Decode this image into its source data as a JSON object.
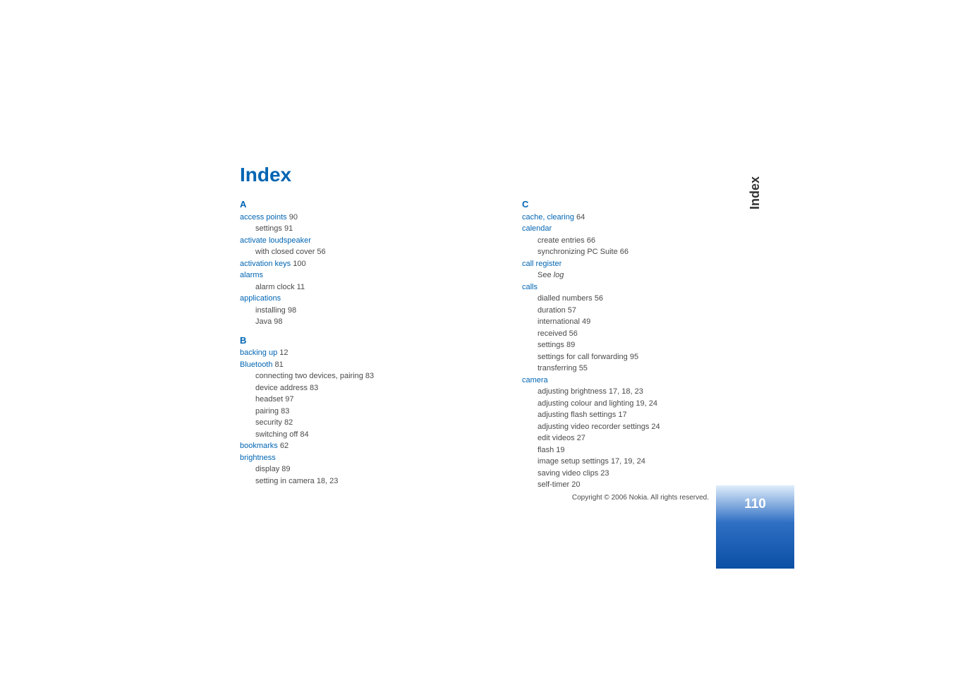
{
  "header": {
    "title": "Index",
    "side_tab": "Index"
  },
  "footer": {
    "copyright": "Copyright © 2006 Nokia. All rights reserved.",
    "page_number": "110"
  },
  "index": {
    "col1": [
      {
        "type": "letter",
        "text": "A"
      },
      {
        "type": "term",
        "text": "access points",
        "page": " 90"
      },
      {
        "type": "sub",
        "text": "settings 91"
      },
      {
        "type": "term",
        "text": "activate loudspeaker",
        "page": ""
      },
      {
        "type": "sub",
        "text": "with closed cover 56"
      },
      {
        "type": "term",
        "text": "activation keys",
        "page": " 100"
      },
      {
        "type": "term",
        "text": "alarms",
        "page": ""
      },
      {
        "type": "sub",
        "text": "alarm clock 11"
      },
      {
        "type": "term",
        "text": "applications",
        "page": ""
      },
      {
        "type": "sub",
        "text": "installing 98"
      },
      {
        "type": "sub",
        "text": "Java 98"
      },
      {
        "type": "letter",
        "text": "B"
      },
      {
        "type": "term",
        "text": "backing up",
        "page": " 12"
      },
      {
        "type": "term",
        "text": "Bluetooth",
        "page": " 81"
      },
      {
        "type": "sub",
        "text": "connecting two devices, pairing 83"
      },
      {
        "type": "sub",
        "text": "device address 83"
      },
      {
        "type": "sub",
        "text": "headset 97"
      },
      {
        "type": "sub",
        "text": "pairing 83"
      },
      {
        "type": "sub",
        "text": "security 82"
      },
      {
        "type": "sub",
        "text": "switching off 84"
      },
      {
        "type": "term",
        "text": "bookmarks",
        "page": " 62"
      },
      {
        "type": "term",
        "text": "brightness",
        "page": ""
      },
      {
        "type": "sub",
        "text": "display 89"
      },
      {
        "type": "sub",
        "text": "setting in camera 18, 23"
      }
    ],
    "col2": [
      {
        "type": "letter",
        "text": "C"
      },
      {
        "type": "term",
        "text": "cache, clearing",
        "page": " 64"
      },
      {
        "type": "term",
        "text": "calendar",
        "page": ""
      },
      {
        "type": "sub",
        "text": "create entries 66"
      },
      {
        "type": "sub",
        "text": "synchronizing PC Suite 66"
      },
      {
        "type": "term",
        "text": "call register",
        "page": ""
      },
      {
        "type": "sub-see",
        "prefix": "See ",
        "italic": "log"
      },
      {
        "type": "term",
        "text": "calls",
        "page": ""
      },
      {
        "type": "sub",
        "text": "dialled numbers 56"
      },
      {
        "type": "sub",
        "text": "duration 57"
      },
      {
        "type": "sub",
        "text": "international 49"
      },
      {
        "type": "sub",
        "text": "received 56"
      },
      {
        "type": "sub",
        "text": "settings 89"
      },
      {
        "type": "sub",
        "text": "settings for call forwarding 95"
      },
      {
        "type": "sub",
        "text": "transferring 55"
      },
      {
        "type": "term",
        "text": "camera",
        "page": ""
      },
      {
        "type": "sub",
        "text": "adjusting brightness 17, 18, 23"
      },
      {
        "type": "sub",
        "text": "adjusting colour and lighting 19, 24"
      },
      {
        "type": "sub",
        "text": "adjusting flash settings 17"
      },
      {
        "type": "sub",
        "text": "adjusting video recorder settings 24"
      },
      {
        "type": "sub",
        "text": "edit videos 27"
      },
      {
        "type": "sub",
        "text": "flash 19"
      },
      {
        "type": "sub",
        "text": "image setup settings 17, 19, 24"
      },
      {
        "type": "sub",
        "text": "saving video clips 23"
      },
      {
        "type": "sub",
        "text": "self-timer 20"
      }
    ]
  }
}
